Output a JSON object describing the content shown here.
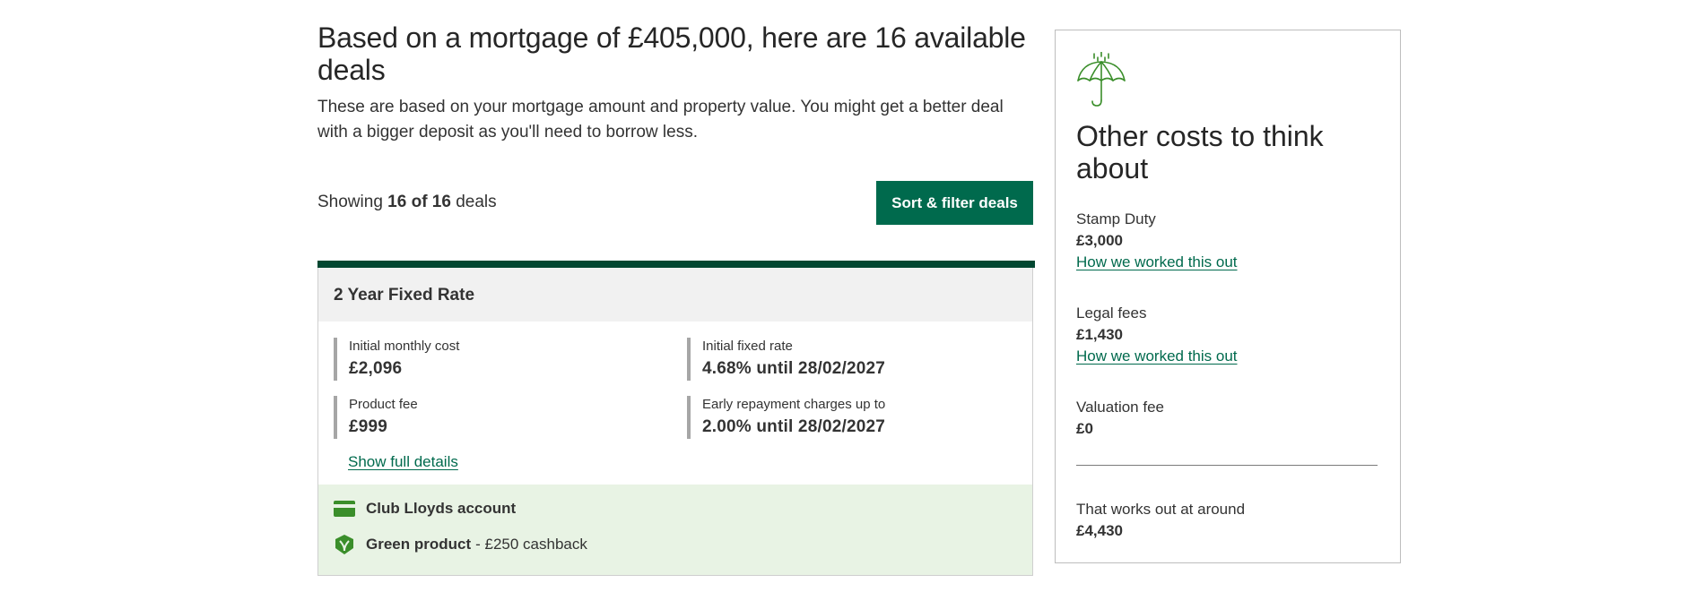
{
  "headline": "Based on a mortgage of £405,000, here are 16 available deals",
  "intro": "These are based on your mortgage amount and property value. You might get a better deal with a bigger deposit as you'll need to borrow less.",
  "results": {
    "prefix": "Showing",
    "count": "16 of 16",
    "suffix": "deals",
    "sort_button": "Sort & filter deals"
  },
  "deal": {
    "title": "2 Year Fixed Rate",
    "stats": {
      "monthly": {
        "label": "Initial monthly cost",
        "value": "£2,096"
      },
      "rate": {
        "label": "Initial fixed rate",
        "value": "4.68% until 28/02/2027"
      },
      "fee": {
        "label": "Product fee",
        "value": "£999"
      },
      "erc": {
        "label": "Early repayment charges up to",
        "value": "2.00% until 28/02/2027"
      }
    },
    "details_link": "Show full details",
    "features": {
      "club": {
        "name": "Club Lloyds account",
        "icon": "card-icon"
      },
      "green": {
        "name": "Green product",
        "desc": "- £250 cashback",
        "icon": "green-leaf-icon"
      }
    }
  },
  "costs": {
    "icon": "umbrella-icon",
    "title": "Other costs to think about",
    "stamp_duty": {
      "label": "Stamp Duty",
      "value": "£3,000",
      "link": "How we worked this out"
    },
    "legal_fees": {
      "label": "Legal fees",
      "value": "£1,430",
      "link": "How we worked this out"
    },
    "valuation_fee": {
      "label": "Valuation fee",
      "value": "£0"
    },
    "total": {
      "label": "That works out at around",
      "value": "£4,430"
    }
  },
  "colors": {
    "brand_green": "#006a4d",
    "dark_green": "#024731",
    "feature_bg": "#e8f3e4",
    "icon_green": "#3a8e2a"
  }
}
